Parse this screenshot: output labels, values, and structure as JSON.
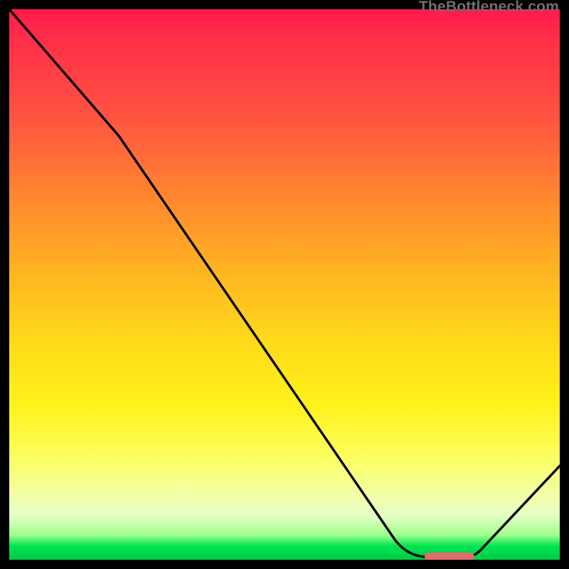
{
  "watermark": {
    "text": "TheBottleneck.com"
  },
  "chart_data": {
    "type": "line",
    "title": "",
    "xlabel": "",
    "ylabel": "",
    "xlim": [
      0,
      100
    ],
    "ylim": [
      0,
      100
    ],
    "grid": false,
    "legend": false,
    "series": [
      {
        "name": "bottleneck-curve",
        "x": [
          0,
          20,
          70,
          77,
          83,
          100
        ],
        "values": [
          100,
          77,
          3,
          0.5,
          0.5,
          17
        ],
        "color": "#000000"
      }
    ],
    "marker": {
      "name": "optimal-marker",
      "x_start": 75.5,
      "x_end": 84.5,
      "y": 0.5,
      "color": "#e26b6e"
    },
    "gradient_stops": [
      {
        "pct": 0,
        "color": "#ff1a4d"
      },
      {
        "pct": 20,
        "color": "#ff5540"
      },
      {
        "pct": 48,
        "color": "#ffb522"
      },
      {
        "pct": 72,
        "color": "#fff21a"
      },
      {
        "pct": 92,
        "color": "#e4ffc4"
      },
      {
        "pct": 100,
        "color": "#00cc44"
      }
    ]
  }
}
